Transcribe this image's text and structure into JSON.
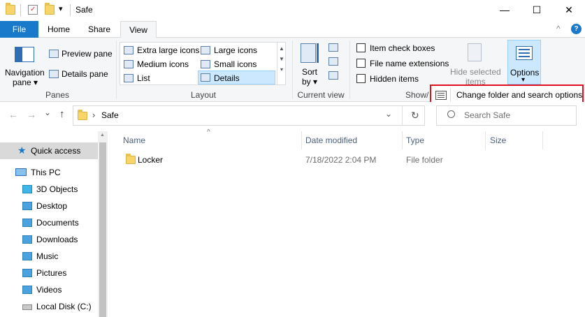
{
  "window": {
    "title": "Safe",
    "minimize_glyph": "—",
    "maximize_glyph": "☐",
    "close_glyph": "✕",
    "qa_dropdown_glyph": "▾"
  },
  "tabs": {
    "file": "File",
    "home": "Home",
    "share": "Share",
    "view": "View",
    "collapse_glyph": "^",
    "help_glyph": "?"
  },
  "ribbon": {
    "panes": {
      "label": "Panes",
      "navigation_pane_line1": "Navigation",
      "navigation_pane_line2": "pane ▾",
      "preview_pane": "Preview pane",
      "details_pane": "Details pane"
    },
    "layout": {
      "label": "Layout",
      "items": [
        "Extra large icons",
        "Large icons",
        "Medium icons",
        "Small icons",
        "List",
        "Details"
      ]
    },
    "current_view": {
      "label": "Current view",
      "sort_by_line1": "Sort",
      "sort_by_line2": "by ▾"
    },
    "show_hide": {
      "label": "Show/",
      "item_check_boxes": "Item check boxes",
      "file_name_extensions": "File name extensions",
      "hidden_items": "Hidden items",
      "hide_selected_line1": "Hide selected",
      "hide_selected_line2": "items"
    },
    "options": {
      "label": "Options",
      "dropdown_glyph": "▾",
      "menu_item": "Change folder and search options"
    }
  },
  "address": {
    "back_glyph": "←",
    "forward_glyph": "→",
    "recent_glyph": "⌄",
    "up_glyph": "↑",
    "breadcrumb_sep": "›",
    "path": "Safe",
    "dropdown_glyph": "⌄",
    "refresh_glyph": "↻",
    "search_placeholder": "Search Safe"
  },
  "nav": {
    "items": [
      {
        "label": "Quick access",
        "icon": "star-icon"
      },
      {
        "label": "This PC",
        "icon": "computer-icon"
      },
      {
        "label": "3D Objects",
        "icon": "cube-icon"
      },
      {
        "label": "Desktop",
        "icon": "desktop-folder-icon"
      },
      {
        "label": "Documents",
        "icon": "documents-folder-icon"
      },
      {
        "label": "Downloads",
        "icon": "downloads-folder-icon"
      },
      {
        "label": "Music",
        "icon": "music-folder-icon"
      },
      {
        "label": "Pictures",
        "icon": "pictures-folder-icon"
      },
      {
        "label": "Videos",
        "icon": "videos-folder-icon"
      },
      {
        "label": "Local Disk (C:)",
        "icon": "drive-icon"
      }
    ]
  },
  "files": {
    "sort_glyph": "^",
    "columns": [
      "Name",
      "Date modified",
      "Type",
      "Size"
    ],
    "rows": [
      {
        "name": "Locker",
        "date": "7/18/2022 2:04 PM",
        "type": "File folder",
        "size": ""
      }
    ]
  },
  "colors": {
    "file_tab": "#1979ca",
    "highlight": "#e0101e",
    "selected": "#cce8ff"
  }
}
